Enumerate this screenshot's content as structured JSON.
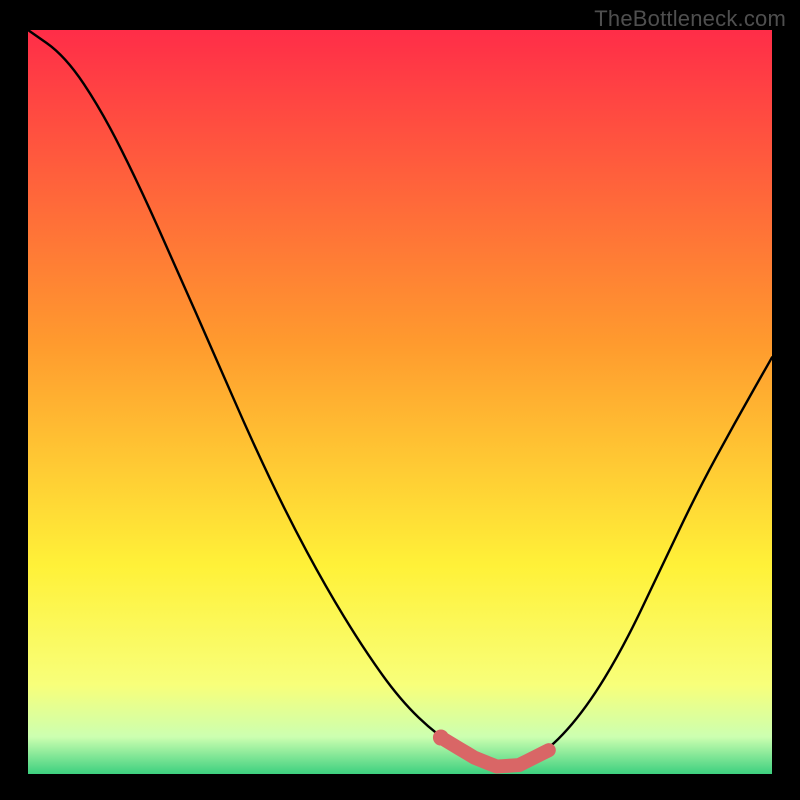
{
  "attribution": "TheBottleneck.com",
  "colors": {
    "background": "#000000",
    "gradient_top": "#ff2d48",
    "gradient_mid_top": "#ff9a2e",
    "gradient_mid": "#fff138",
    "gradient_mid_low1": "#f8ff7a",
    "gradient_mid_low2": "#ccffb0",
    "gradient_bottom": "#3dd07f",
    "curve": "#000000",
    "highlight_stroke": "#d96666",
    "highlight_fill": "#d96666"
  },
  "chart_data": {
    "type": "line",
    "title": "",
    "xlabel": "",
    "ylabel": "",
    "xlim": [
      0,
      1
    ],
    "ylim": [
      0,
      1
    ],
    "series": [
      {
        "name": "bottleneck-curve",
        "x": [
          0.0,
          0.05,
          0.1,
          0.15,
          0.2,
          0.25,
          0.3,
          0.35,
          0.4,
          0.45,
          0.5,
          0.55,
          0.6,
          0.63,
          0.66,
          0.7,
          0.75,
          0.8,
          0.85,
          0.9,
          0.95,
          1.0
        ],
        "values": [
          1.0,
          0.965,
          0.89,
          0.79,
          0.678,
          0.565,
          0.45,
          0.345,
          0.252,
          0.17,
          0.1,
          0.052,
          0.022,
          0.01,
          0.012,
          0.032,
          0.088,
          0.17,
          0.275,
          0.38,
          0.472,
          0.56
        ]
      }
    ],
    "highlight_range_x": [
      0.56,
      0.7
    ],
    "highlight_dot_x": 0.555,
    "annotations": []
  }
}
